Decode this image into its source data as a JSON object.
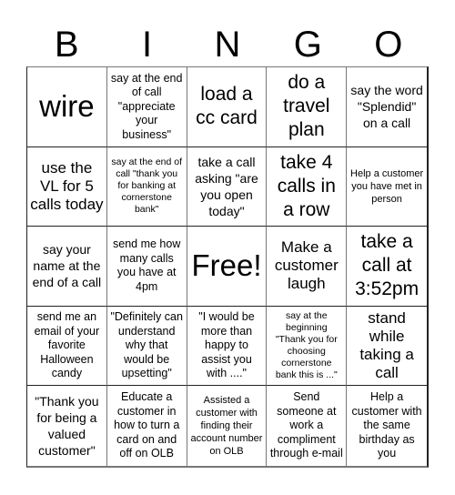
{
  "header": {
    "letters": [
      "B",
      "I",
      "N",
      "G",
      "O"
    ]
  },
  "cells": [
    {
      "text": "wire",
      "size": "s-xl"
    },
    {
      "text": "say at the end of call \"appreciate your business\"",
      "size": "s-s"
    },
    {
      "text": "load a cc card",
      "size": "s-l"
    },
    {
      "text": "do a travel plan",
      "size": "s-l"
    },
    {
      "text": "say the word \"Splendid\" on a call",
      "size": "s-sm"
    },
    {
      "text": "use the VL for 5 calls today",
      "size": "s-m"
    },
    {
      "text": "say at the end of call \"thank you for banking at cornerstone bank\"",
      "size": "s-xxs"
    },
    {
      "text": "take a call asking \"are you open today\"",
      "size": "s-sm"
    },
    {
      "text": "take 4 calls in a row",
      "size": "s-l"
    },
    {
      "text": "Help a customer you have met in person",
      "size": "s-xs"
    },
    {
      "text": "say your name at the end of a call",
      "size": "s-sm"
    },
    {
      "text": "send me how many calls you have at 4pm",
      "size": "s-s"
    },
    {
      "text": "Free!",
      "size": "s-xl"
    },
    {
      "text": "Make a customer laugh",
      "size": "s-m"
    },
    {
      "text": "take a call at 3:52pm",
      "size": "s-l"
    },
    {
      "text": "send me an email of your favorite Halloween candy",
      "size": "s-s"
    },
    {
      "text": "\"Definitely can understand why that would be upsetting\"",
      "size": "s-s"
    },
    {
      "text": "\"I would be more than happy to assist you with ....\"",
      "size": "s-s"
    },
    {
      "text": "say at the beginning \"Thank you for choosing cornerstone bank this is ...\"",
      "size": "s-xxs"
    },
    {
      "text": "stand while taking a call",
      "size": "s-m"
    },
    {
      "text": "\"Thank you for being a valued customer\"",
      "size": "s-sm"
    },
    {
      "text": "Educate a customer in how to turn a card on and off on OLB",
      "size": "s-s"
    },
    {
      "text": "Assisted a customer with finding their account number on OLB",
      "size": "s-xs"
    },
    {
      "text": "Send someone at work a compliment through e-mail",
      "size": "s-s"
    },
    {
      "text": "Help a customer with the same birthday as you",
      "size": "s-s"
    }
  ]
}
